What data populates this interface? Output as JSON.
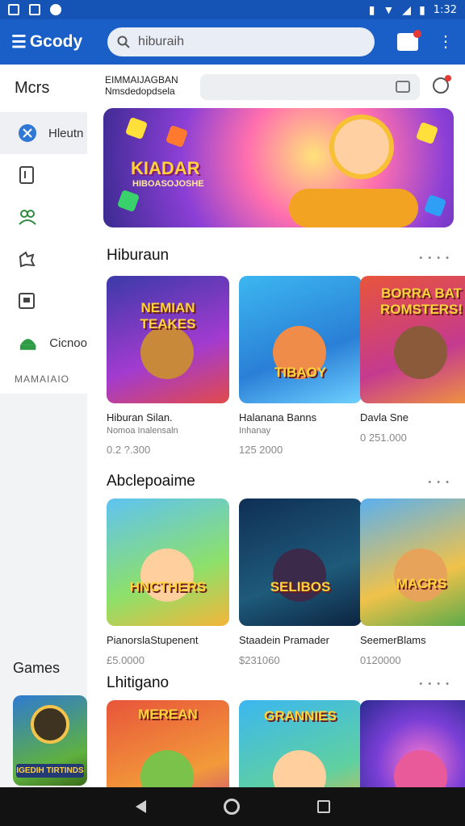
{
  "status_bar": {
    "time": "1:32"
  },
  "app_bar": {
    "title": "Gcody",
    "search_placeholder": "hiburaih"
  },
  "drawer": {
    "title": "Mcrs",
    "items": [
      {
        "label": "Hleutn",
        "icon": "compass-icon"
      },
      {
        "label": "",
        "icon": "tablet-icon"
      },
      {
        "label": "",
        "icon": "people-icon"
      },
      {
        "label": "",
        "icon": "puzzle-icon"
      },
      {
        "label": "",
        "icon": "window-icon"
      },
      {
        "label": "Cicnoo",
        "icon": "android-icon"
      }
    ],
    "section_label": "MAMAIAIO",
    "games_label": "Games",
    "games_thumb_text": "IGEDIH TIRTINDS"
  },
  "main": {
    "subhead_line1": "EIMMAIJAGBAN",
    "subhead_line2": "Nmsdedopdsela",
    "banner": {
      "title": "KIADAR",
      "subtitle": "HIBOASOJOSHE"
    },
    "sections": [
      {
        "title": "Hiburaun",
        "more": "• • • •",
        "cards": [
          {
            "thumb_text": "NEMIAN TEAKES",
            "name": "Hiburan Silan.",
            "sub": "Nomoa Inalensaln",
            "price": "0.2 ?.300"
          },
          {
            "thumb_text": "TIBAOY",
            "name": "Halanana Banns",
            "sub": "Inhanay",
            "price": "125 2000"
          },
          {
            "thumb_text": "BORRA BAT ROMSTERS!",
            "name": "Davla Sne",
            "sub": "",
            "price": "0 251.000"
          }
        ]
      },
      {
        "title": "Abclepoaime",
        "more": "• • •",
        "cards": [
          {
            "thumb_text": "HNCTHERS",
            "name": "PianorslaStupenent",
            "sub": "",
            "price": "£5.0000"
          },
          {
            "thumb_text": "SELIBOS",
            "name": "Staadein Pramader",
            "sub": "",
            "price": "$231060"
          },
          {
            "thumb_text": "MACRS",
            "name": "SeemerBlams",
            "sub": "",
            "price": "0120000"
          }
        ]
      },
      {
        "title": "Lhitigano",
        "more": "• • • •",
        "cards": [
          {
            "thumb_text": "MEREAN",
            "name": "",
            "sub": "",
            "price": ""
          },
          {
            "thumb_text": "GRANNIES",
            "name": "",
            "sub": "",
            "price": ""
          },
          {
            "thumb_text": "",
            "name": "",
            "sub": "",
            "price": ""
          }
        ]
      }
    ]
  },
  "colors": {
    "primary": "#1a5fc8",
    "status_bar": "#1554b4",
    "badge": "#e53935",
    "nav_bar": "#121212"
  }
}
